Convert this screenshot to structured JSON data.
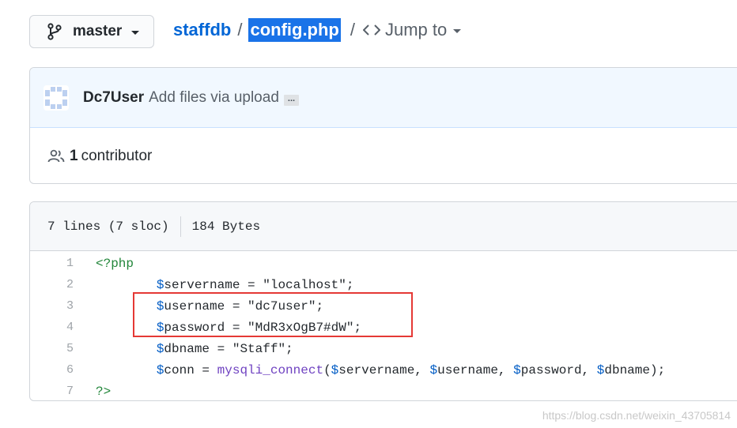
{
  "branch": {
    "label": "master"
  },
  "breadcrumb": {
    "repo": "staffdb",
    "separator": "/",
    "file": "config.php",
    "jump_label": "Jump to"
  },
  "commit": {
    "author": "Dc7User",
    "message": "Add files via upload",
    "ellipsis": "..."
  },
  "contributors": {
    "count": "1",
    "label": "contributor"
  },
  "file_info": {
    "lines": "7 lines (7 sloc)",
    "size": "184 Bytes"
  },
  "code_lines": [
    {
      "num": "1",
      "parts": [
        {
          "t": "<?php",
          "c": "kw"
        }
      ]
    },
    {
      "num": "2",
      "parts": [
        {
          "t": "        "
        },
        {
          "t": "$",
          "c": "var"
        },
        {
          "t": "servername = \"localhost\";"
        }
      ]
    },
    {
      "num": "3",
      "parts": [
        {
          "t": "        "
        },
        {
          "t": "$",
          "c": "var"
        },
        {
          "t": "username = \"dc7user\";"
        }
      ]
    },
    {
      "num": "4",
      "parts": [
        {
          "t": "        "
        },
        {
          "t": "$",
          "c": "var"
        },
        {
          "t": "password = \"MdR3xOgB7#dW\";"
        }
      ]
    },
    {
      "num": "5",
      "parts": [
        {
          "t": "        "
        },
        {
          "t": "$",
          "c": "var"
        },
        {
          "t": "dbname = \"Staff\";"
        }
      ]
    },
    {
      "num": "6",
      "parts": [
        {
          "t": "        "
        },
        {
          "t": "$",
          "c": "var"
        },
        {
          "t": "conn = "
        },
        {
          "t": "mysqli_connect",
          "c": "fn"
        },
        {
          "t": "("
        },
        {
          "t": "$",
          "c": "var"
        },
        {
          "t": "servername, "
        },
        {
          "t": "$",
          "c": "var"
        },
        {
          "t": "username, "
        },
        {
          "t": "$",
          "c": "var"
        },
        {
          "t": "password, "
        },
        {
          "t": "$",
          "c": "var"
        },
        {
          "t": "dbname);"
        }
      ]
    },
    {
      "num": "7",
      "parts": [
        {
          "t": "?>",
          "c": "kw"
        }
      ]
    }
  ],
  "watermark": "https://blog.csdn.net/weixin_43705814",
  "colors": {
    "link": "#0366d6",
    "selection": "#1a73e8",
    "annotation": "#e53935"
  }
}
